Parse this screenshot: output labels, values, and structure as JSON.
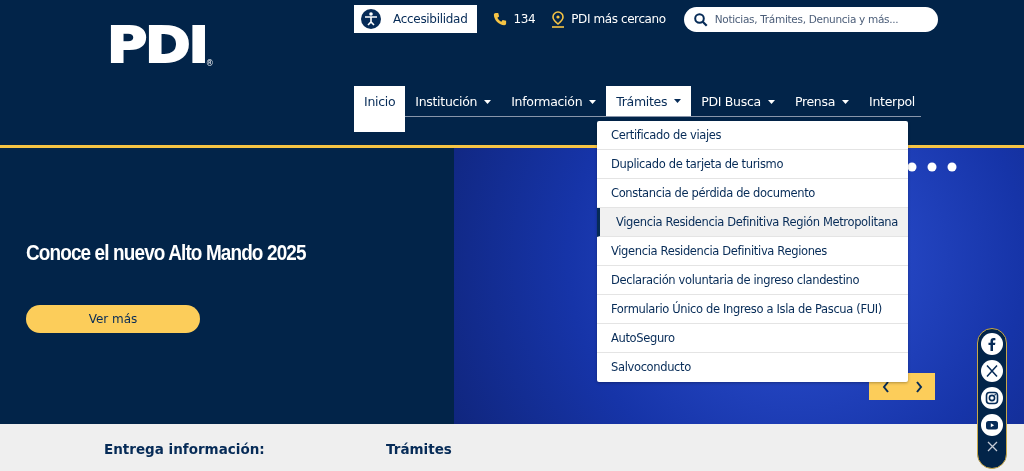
{
  "logo": {
    "text": "PDI",
    "mark": "®"
  },
  "utility": {
    "accessibility": "Accesibilidad",
    "phone": "134",
    "nearest": "PDI más cercano"
  },
  "search": {
    "placeholder": "Noticias, Trámites, Denuncia y más..."
  },
  "nav": [
    {
      "label": "Inicio",
      "dropdown": false,
      "selected": true,
      "expanded": false
    },
    {
      "label": "Institución",
      "dropdown": true,
      "selected": false,
      "expanded": false
    },
    {
      "label": "Información",
      "dropdown": true,
      "selected": false,
      "expanded": false
    },
    {
      "label": "Trámites",
      "dropdown": true,
      "selected": false,
      "expanded": true
    },
    {
      "label": "PDI Busca",
      "dropdown": true,
      "selected": false,
      "expanded": false
    },
    {
      "label": "Prensa",
      "dropdown": true,
      "selected": false,
      "expanded": false
    },
    {
      "label": "Interpol",
      "dropdown": false,
      "selected": false,
      "expanded": false
    }
  ],
  "menu": [
    {
      "label": "Certificado de viajes",
      "selected": false
    },
    {
      "label": "Duplicado de tarjeta de turismo",
      "selected": false
    },
    {
      "label": "Constancia de pérdida de documento",
      "selected": false
    },
    {
      "label": "Vigencia Residencia Definitiva Región Metropolitana",
      "selected": true
    },
    {
      "label": "Vigencia Residencia Definitiva Regiones",
      "selected": false
    },
    {
      "label": "Declaración voluntaria de ingreso clandestino",
      "selected": false
    },
    {
      "label": "Formulario Único de Ingreso a Isla de Pascua (FUI)",
      "selected": false
    },
    {
      "label": "AutoSeguro",
      "selected": false
    },
    {
      "label": "Salvoconducto",
      "selected": false
    }
  ],
  "hero": {
    "title": "Conoce el nuevo Alto Mando 2025",
    "button": "Ver más"
  },
  "social": [
    {
      "kind": "facebook"
    },
    {
      "kind": "x"
    },
    {
      "kind": "instagram"
    },
    {
      "kind": "youtube"
    }
  ],
  "sections": [
    "Entrega información:",
    "Trámites"
  ]
}
